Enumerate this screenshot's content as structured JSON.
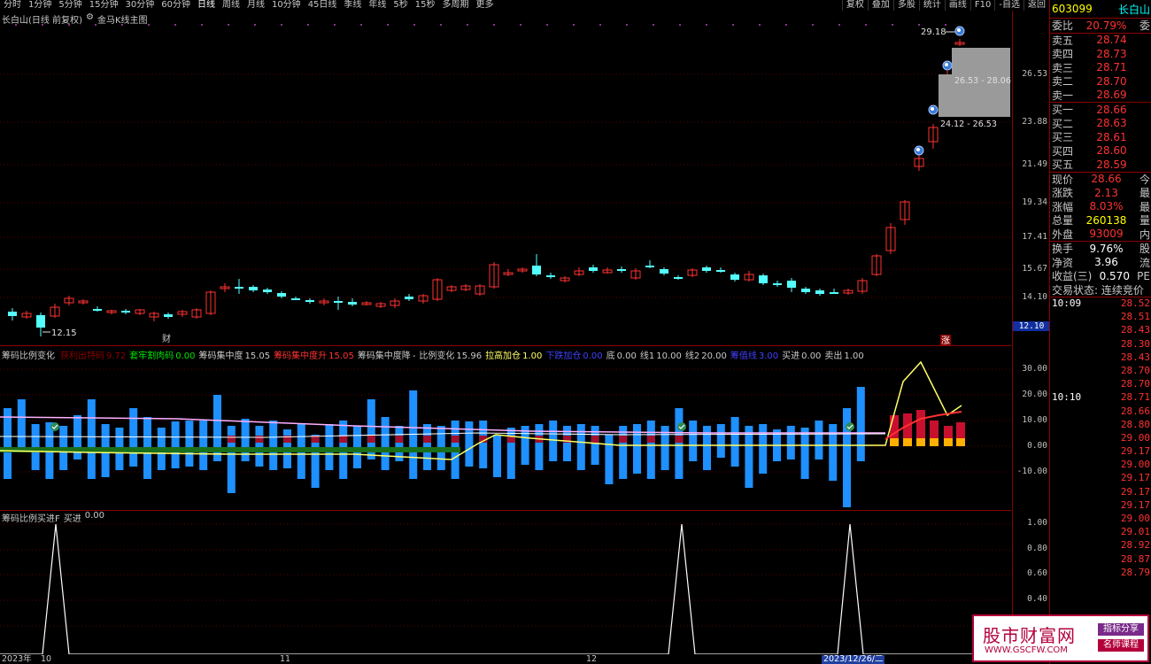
{
  "toolbar": {
    "periods": [
      "分时",
      "1分钟",
      "5分钟",
      "15分钟",
      "30分钟",
      "60分钟",
      "日线",
      "周线",
      "月线",
      "10分钟",
      "45日线",
      "季线",
      "年线",
      "5秒",
      "15秒",
      "多周期",
      "更多"
    ],
    "right_buttons": [
      "复权",
      "叠加",
      "多股",
      "统计",
      "画线",
      "F10",
      "-自选",
      "返回"
    ]
  },
  "main_chart": {
    "title": "长白山(日线 前复权)",
    "indicator": "金马K线主图",
    "y_ticks": [
      "26.53",
      "23.88",
      "21.49",
      "19.34",
      "17.41",
      "15.67",
      "14.10"
    ],
    "price_labels": {
      "high": "29.18",
      "low": "12.15",
      "last": "12.10"
    },
    "boxes": [
      "26.53 - 28.06",
      "24.12 - 26.53"
    ],
    "markers": {
      "cai": "财",
      "zhang": "涨"
    }
  },
  "indicator1": {
    "items": [
      {
        "name": "筹码比例变化",
        "value": "",
        "color": "#c8c8c8"
      },
      {
        "name": "获利出特码",
        "value": "9.72",
        "color": "#8b0000"
      },
      {
        "name": "套牢割肉码",
        "value": "0.00",
        "color": "#00e600"
      },
      {
        "name": "筹码集中度",
        "value": "15.05",
        "color": "#c8c8c8"
      },
      {
        "name": "筹码集中度升",
        "value": "15.05",
        "color": "#ff3232"
      },
      {
        "name": "筹码集中度降",
        "value": "-",
        "color": "#c8c8c8"
      },
      {
        "name": "比例变化",
        "value": "15.96",
        "color": "#c8c8c8"
      },
      {
        "name": "拉高加仓",
        "value": "1.00",
        "color": "#ffff64"
      },
      {
        "name": "下跌加仓",
        "value": "0.00",
        "color": "#4040ff"
      },
      {
        "name": "底",
        "value": "0.00",
        "color": "#c8c8c8"
      },
      {
        "name": "线1",
        "value": "10.00",
        "color": "#c8c8c8"
      },
      {
        "name": "线2",
        "value": "20.00",
        "color": "#c8c8c8"
      },
      {
        "name": "筹值线",
        "value": "3.00",
        "color": "#4040ff"
      },
      {
        "name": "买进",
        "value": "0.00",
        "color": "#c8c8c8"
      },
      {
        "name": "卖出",
        "value": "1.00",
        "color": "#c8c8c8"
      }
    ],
    "y_ticks": [
      "30.00",
      "20.00",
      "10.00",
      "0.00",
      "-10.00"
    ]
  },
  "indicator2": {
    "title": "筹码比例买进F",
    "buy_label": "买进",
    "buy_value": "0.00",
    "y_ticks": [
      "1.00",
      "0.80",
      "0.60",
      "0.40"
    ]
  },
  "dates": {
    "d1": "2023年",
    "d2": "10",
    "d3": "11",
    "d4": "12",
    "d5": "2023/12/26/二"
  },
  "side": {
    "code": "603099",
    "name": "长白山",
    "weibi_label": "委比",
    "weibi_value": "20.79%",
    "weibi_extra": "委",
    "sells": [
      {
        "label": "卖五",
        "price": "28.74"
      },
      {
        "label": "卖四",
        "price": "28.73"
      },
      {
        "label": "卖三",
        "price": "28.71"
      },
      {
        "label": "卖二",
        "price": "28.70"
      },
      {
        "label": "卖一",
        "price": "28.69"
      }
    ],
    "buys": [
      {
        "label": "买一",
        "price": "28.66"
      },
      {
        "label": "买二",
        "price": "28.63"
      },
      {
        "label": "买三",
        "price": "28.61"
      },
      {
        "label": "买四",
        "price": "28.60"
      },
      {
        "label": "买五",
        "price": "28.59"
      }
    ],
    "stats": [
      {
        "label": "现价",
        "value": "28.66",
        "extra": "今",
        "cls": "red"
      },
      {
        "label": "涨跌",
        "value": "2.13",
        "extra": "最",
        "cls": "red"
      },
      {
        "label": "涨幅",
        "value": "8.03%",
        "extra": "最",
        "cls": "red"
      },
      {
        "label": "总量",
        "value": "260138",
        "extra": "量",
        "cls": "yellow"
      },
      {
        "label": "外盘",
        "value": "93009",
        "extra": "内",
        "cls": "red"
      }
    ],
    "stats2": [
      {
        "label": "换手",
        "value": "9.76%",
        "extra": "股",
        "cls": "white"
      },
      {
        "label": "净资",
        "value": "3.96",
        "extra": "流",
        "cls": "white"
      },
      {
        "label": "收益(三)",
        "value": "0.570",
        "extra": "PE",
        "cls": "white"
      }
    ],
    "trade_status": "交易状态: 连续竞价",
    "ticks": [
      {
        "time": "10:09",
        "price": "28.52"
      },
      {
        "time": "",
        "price": "28.51"
      },
      {
        "time": "",
        "price": "28.43"
      },
      {
        "time": "",
        "price": "28.30"
      },
      {
        "time": "",
        "price": "28.43"
      },
      {
        "time": "",
        "price": "28.70"
      },
      {
        "time": "",
        "price": "28.70"
      },
      {
        "time": "10:10",
        "price": "28.71"
      },
      {
        "time": "",
        "price": "28.66"
      },
      {
        "time": "",
        "price": "28.80"
      },
      {
        "time": "",
        "price": "29.00"
      },
      {
        "time": "",
        "price": "29.17"
      },
      {
        "time": "",
        "price": "29.00"
      },
      {
        "time": "",
        "price": "29.17"
      },
      {
        "time": "",
        "price": "29.17"
      },
      {
        "time": "",
        "price": "29.17"
      },
      {
        "time": "",
        "price": "29.00"
      },
      {
        "time": "",
        "price": "29.01"
      },
      {
        "time": "",
        "price": "28.92"
      },
      {
        "time": "",
        "price": "28.87"
      },
      {
        "time": "",
        "price": "28.79"
      }
    ]
  },
  "watermark": {
    "main": "股市财富网",
    "tag1": "指标分享",
    "tag2": "名师课程",
    "url": "WWW.GSCFW.COM"
  }
}
